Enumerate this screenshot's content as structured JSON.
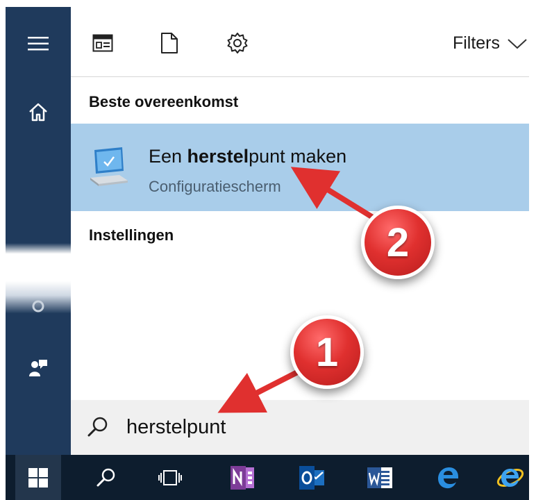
{
  "toolbar": {
    "filters_label": "Filters"
  },
  "sections": {
    "best_match": "Beste overeenkomst",
    "settings": "Instellingen"
  },
  "result": {
    "title_prefix": "Een ",
    "title_bold": "herstel",
    "title_suffix": "punt maken",
    "subtitle": "Configuratiescherm"
  },
  "search": {
    "value": "herstelpunt"
  },
  "annotations": {
    "step1": "1",
    "step2": "2"
  },
  "colors": {
    "rail": "#1f3a5c",
    "highlight": "#a9cdea",
    "taskbar": "#0d1d2e",
    "badge": "#e0302f"
  },
  "icons": {
    "rail": [
      "hamburger-icon",
      "home-icon",
      "settings-icon",
      "feedback-icon"
    ],
    "toolbar": [
      "apps-icon",
      "document-icon",
      "settings-icon",
      "chevron-down-icon"
    ],
    "taskbar": [
      "windows-logo-icon",
      "search-icon",
      "task-view-icon",
      "onenote-icon",
      "outlook-icon",
      "word-icon",
      "edge-icon",
      "internet-explorer-icon"
    ]
  }
}
